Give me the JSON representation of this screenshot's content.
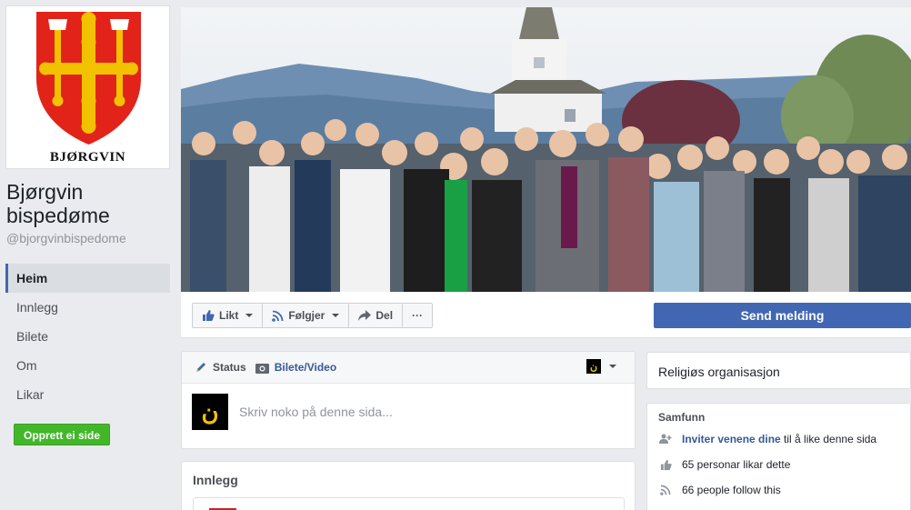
{
  "profile": {
    "logo_text": "BJØRGVIN",
    "name": "Bjørgvin bispedøme",
    "handle": "@bjorgvinbispedome"
  },
  "nav": {
    "items": [
      {
        "label": "Heim",
        "active": true
      },
      {
        "label": "Innlegg",
        "active": false
      },
      {
        "label": "Bilete",
        "active": false
      },
      {
        "label": "Om",
        "active": false
      },
      {
        "label": "Likar",
        "active": false
      }
    ],
    "create_page_label": "Opprett ei side"
  },
  "actions": {
    "like_label": "Likt",
    "follow_label": "Følgjer",
    "share_label": "Del",
    "more_label": "···",
    "send_message_label": "Send melding"
  },
  "composer": {
    "status_label": "Status",
    "photo_video_label": "Bilete/Video",
    "placeholder": "Skriv noko på denne sida..."
  },
  "posts": {
    "title": "Innlegg"
  },
  "about": {
    "category": "Religiøs organisasjon"
  },
  "community": {
    "title": "Samfunn",
    "invite_link": "Inviter venene dine",
    "invite_rest": " til å like denne sida",
    "likes_text": "65 personar likar dette",
    "follows_text": "66 people follow this"
  },
  "colors": {
    "brand_blue": "#4267b2",
    "link_blue": "#365899",
    "green": "#42b72a",
    "shield_red": "#e2231a",
    "shield_gold": "#f2c200"
  }
}
